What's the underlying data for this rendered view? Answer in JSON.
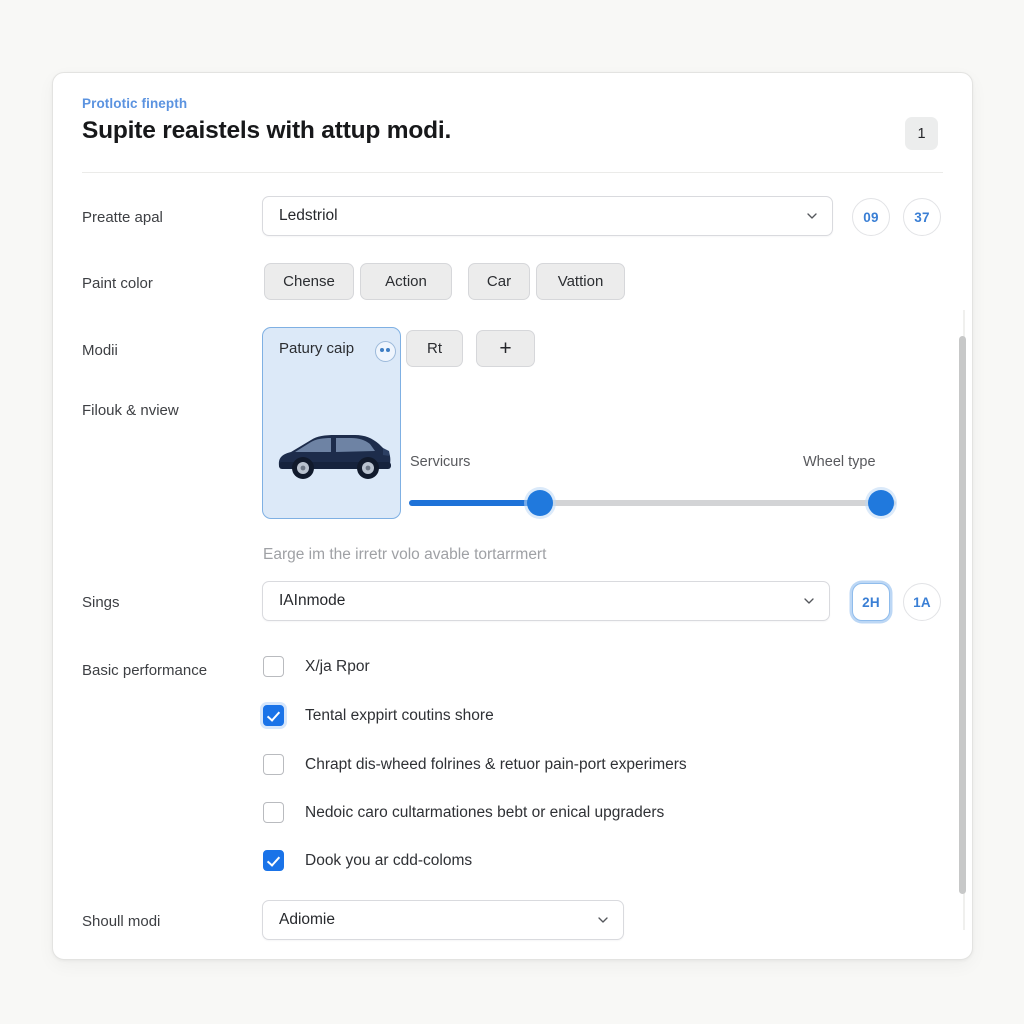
{
  "header": {
    "eyebrow": "Protlotic finepth",
    "title": "Supite reaistels with attup modi.",
    "count_badge": "1"
  },
  "rows": {
    "row1": {
      "label": "Preatte apal",
      "select_value": "Ledstriol",
      "badge_a": "09",
      "badge_b": "37"
    },
    "row2": {
      "label": "Paint color",
      "buttons": [
        "Chense",
        "Action",
        "Car",
        "Vattion"
      ]
    },
    "row3": {
      "label": "Modii",
      "chip_label": "Patury caip",
      "chip_icon": "eye-icon",
      "buttons": [
        "Rt",
        "+"
      ]
    },
    "row4": {
      "label": "Filouk & nview"
    },
    "slider": {
      "left_label": "Servicurs",
      "right_label": "Wheel type",
      "thumb_a_percent": 27,
      "thumb_b_percent": 97
    },
    "helper_text": "Earge im the irretr volo avable tortarrmert",
    "row5": {
      "label": "Sings",
      "select_value": "IAInmode",
      "badge_a": "2H",
      "badge_b": "1A"
    },
    "row6": {
      "label": "Basic performance",
      "checkboxes": [
        {
          "label": "X/ja Rpor",
          "checked": false
        },
        {
          "label": "Tental exppirt coutins shore",
          "checked": true
        },
        {
          "label": "Chrapt dis-wheed folrines & retuor pain-port experimers",
          "checked": false
        },
        {
          "label": "Nedoic caro cultarmationes bebt or enical upgraders",
          "checked": false
        },
        {
          "label": "Dook you ar cdd-coloms",
          "checked": true
        }
      ]
    },
    "row7": {
      "label": "Shoull modi",
      "select_value": "Adiomie"
    }
  },
  "colors": {
    "accent_blue": "#1a73e8",
    "eyebrow_blue": "#5b93e0",
    "chip_fill": "#dce9f8",
    "car_body": "#1d2c4b"
  }
}
